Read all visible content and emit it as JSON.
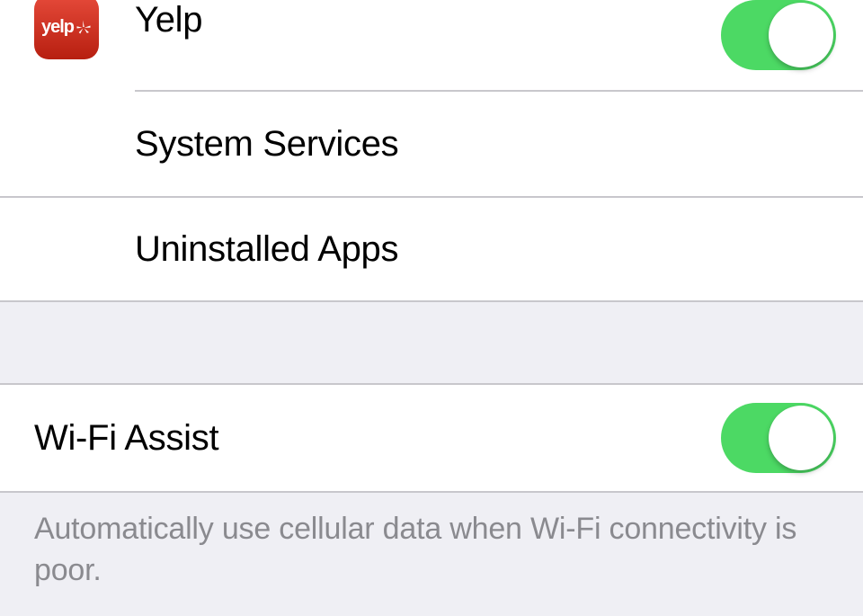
{
  "apps": {
    "yelp": {
      "label": "Yelp",
      "logo_text": "yelp",
      "toggle_on": true
    }
  },
  "rows": {
    "system_services": {
      "label": "System Services"
    },
    "uninstalled_apps": {
      "label": "Uninstalled Apps"
    }
  },
  "wifi_assist": {
    "label": "Wi-Fi Assist",
    "toggle_on": true,
    "footer": "Automatically use cellular data when Wi-Fi connectivity is poor."
  },
  "colors": {
    "toggle_on": "#4cd964",
    "separator": "#c8c7cc",
    "bg_grouped": "#efeff4",
    "footer_text": "#8a8a8f"
  }
}
